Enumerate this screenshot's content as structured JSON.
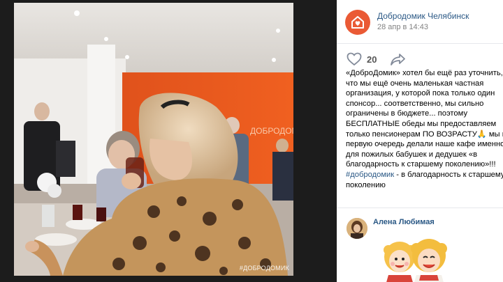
{
  "photo": {
    "watermark": "#ДОБРОДОМИК",
    "wall_sign": "ДОБРОДОМ"
  },
  "post": {
    "group_name": "Добродомик Челябинск",
    "date": "28 апр в 14:43",
    "likes": "20",
    "text_main": "«ДоброДомик» хотел бы ещё раз уточнить,\nчто мы ещё очень маленькая частная\nорганизация, у которой пока только один\nспонсор... соответственно, мы сильно\nограничены в бюджете... поэтому\nБЕСПЛАТНЫЕ обеды мы предоставляем\nтолько пенсионерам ПО ВОЗРАСТУ🙏 мы в\nпервую очередь делали наше кафе именно\nдля пожилых бабушек и дедушек «в\nблагодарность к старшему поколению»!!!\n",
    "hashtag": "#добродомик",
    "text_tail": " - в благодарность к старшему\nпоколению"
  },
  "comment": {
    "author": "Алена Любимая"
  },
  "colors": {
    "brand": "#ea5a35",
    "link": "#2a5885",
    "muted": "#828282",
    "viewer_bg": "#1c1c1c"
  },
  "icons": [
    "group-logo-icon",
    "heart-icon",
    "share-arrow-icon"
  ]
}
